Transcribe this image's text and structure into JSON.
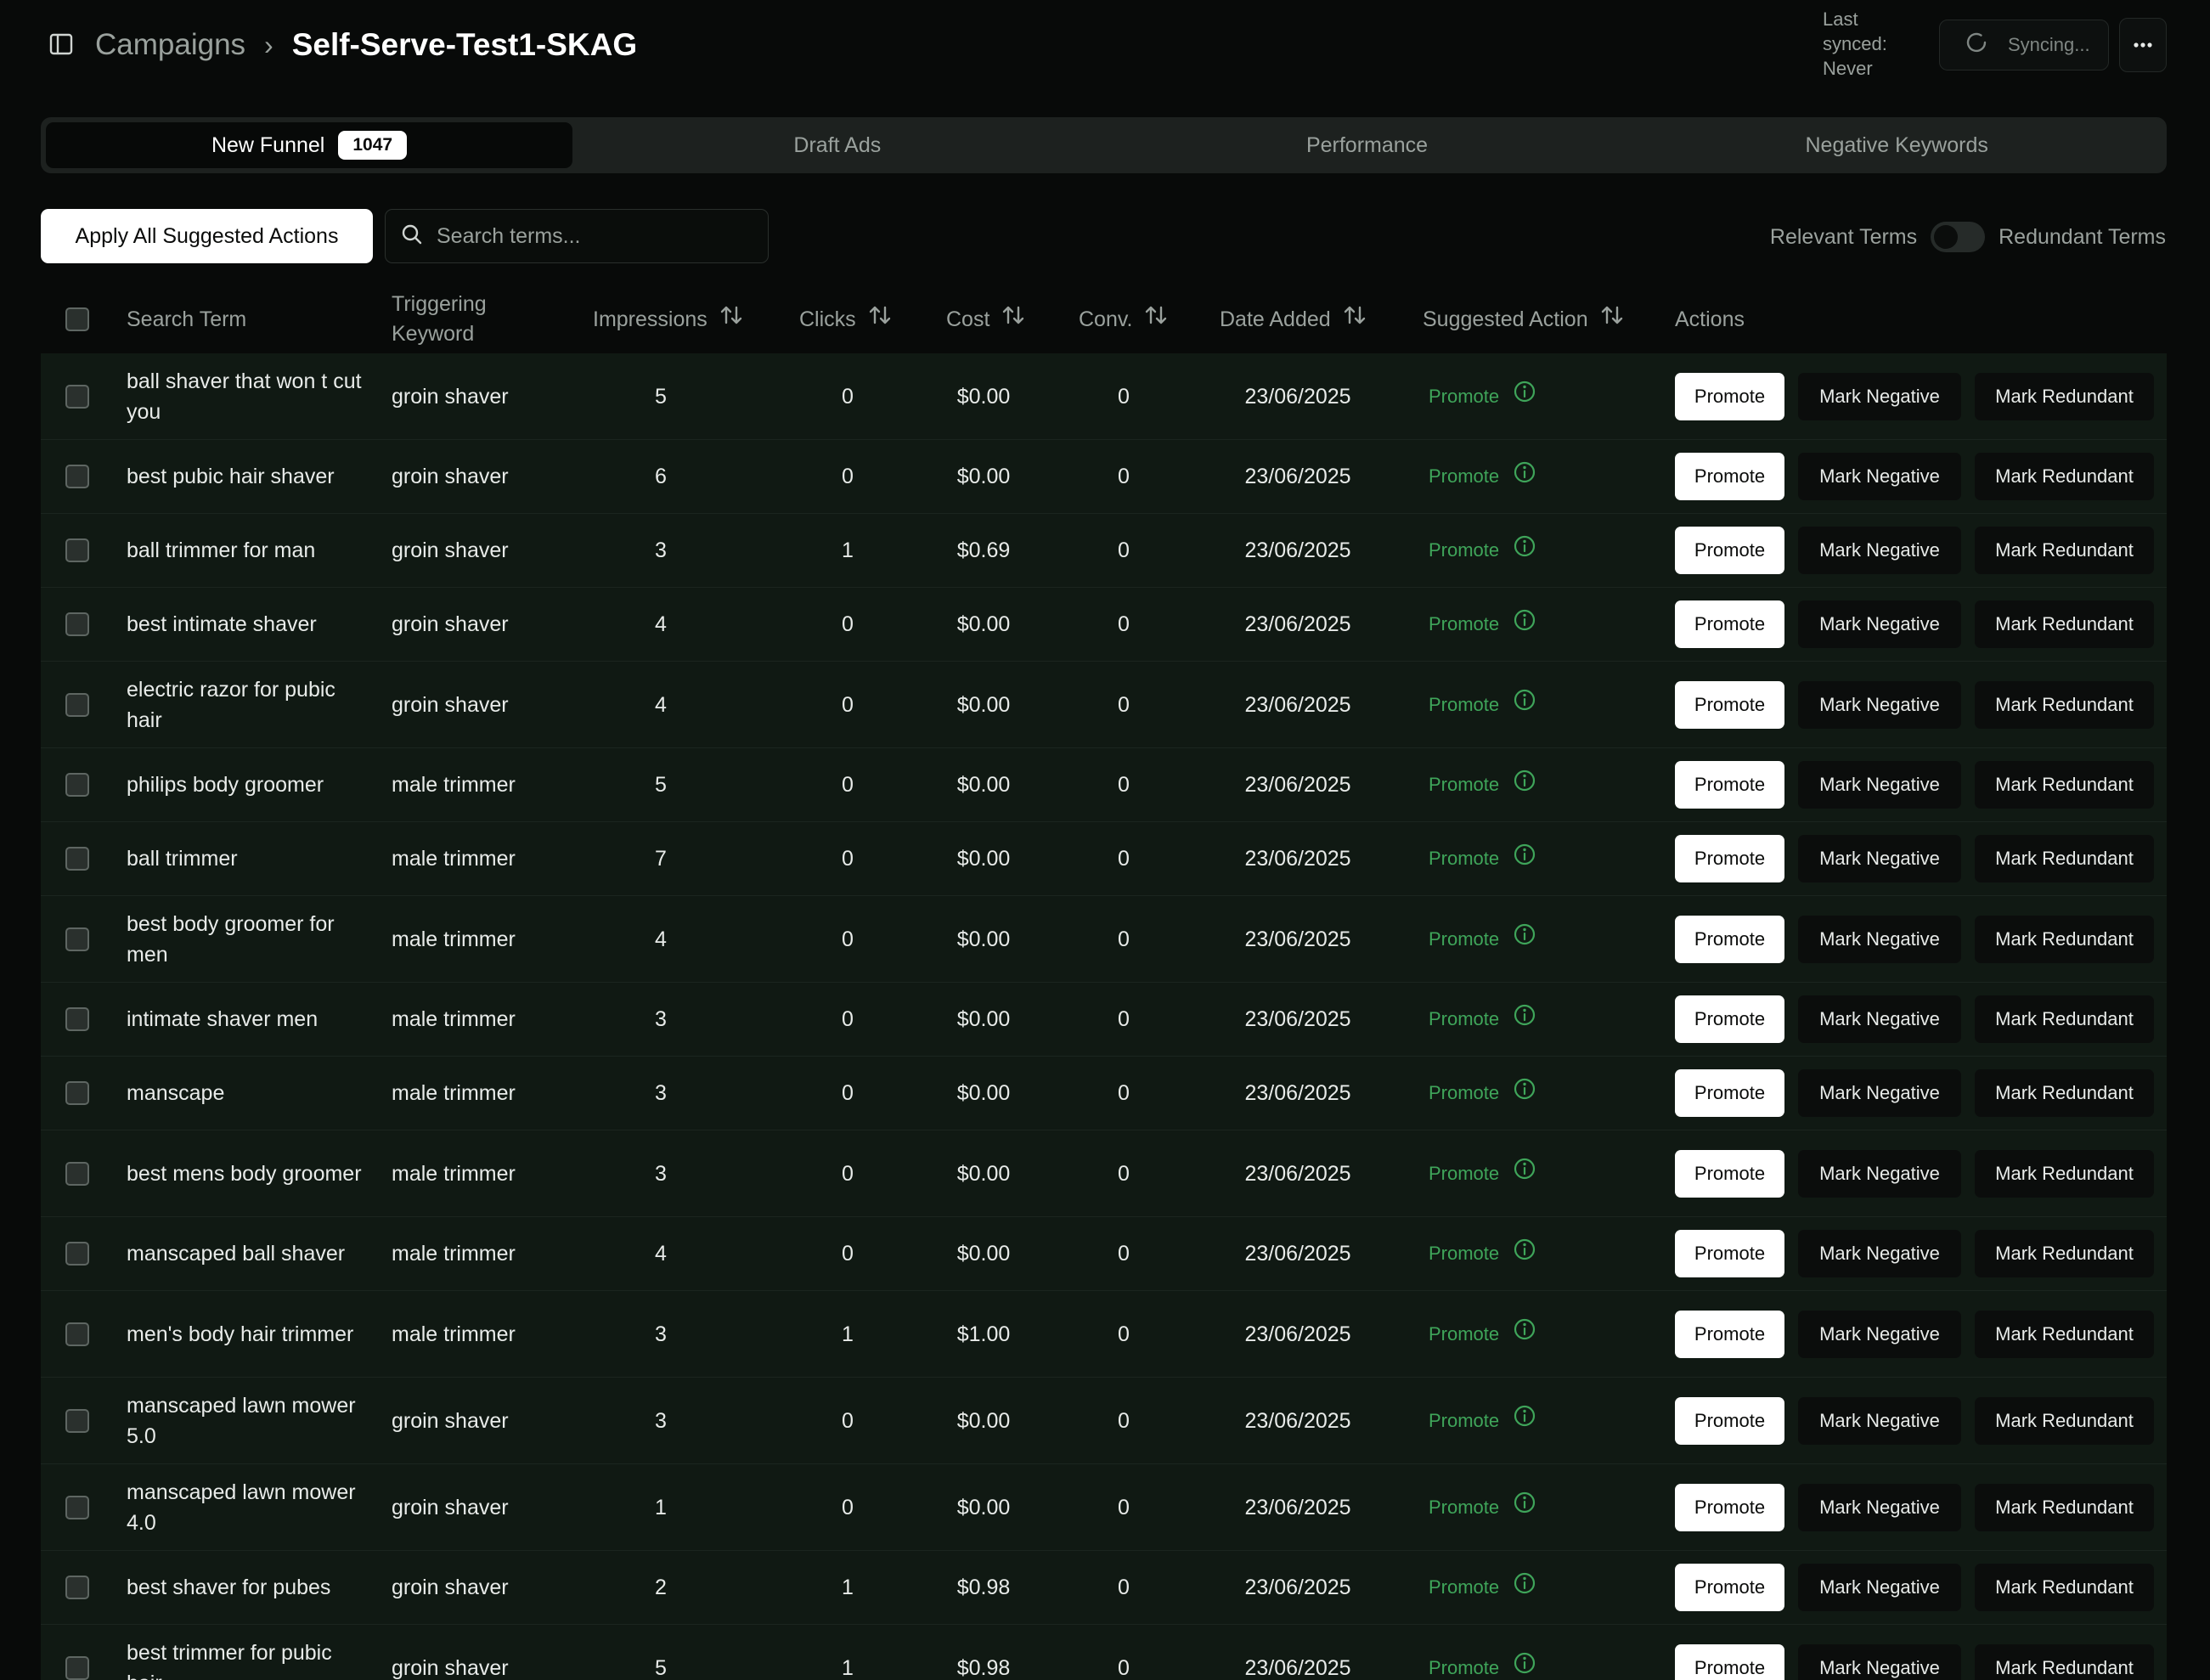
{
  "header": {
    "breadcrumb_parent": "Campaigns",
    "breadcrumb_sep": "›",
    "title": "Self-Serve-Test1-SKAG",
    "last_synced_label": "Last synced: Never",
    "sync_label": "Syncing..."
  },
  "tabs": [
    {
      "label": "New Funnel",
      "badge": "1047"
    },
    {
      "label": "Draft Ads"
    },
    {
      "label": "Performance"
    },
    {
      "label": "Negative Keywords"
    }
  ],
  "toolbar": {
    "apply_label": "Apply All Suggested Actions",
    "search_placeholder": "Search terms...",
    "toggle_left": "Relevant Terms",
    "toggle_right": "Redundant Terms"
  },
  "columns": {
    "search_term": "Search Term",
    "triggering_keyword_line1": "Triggering",
    "triggering_keyword_line2": "Keyword",
    "impressions": "Impressions",
    "clicks": "Clicks",
    "cost": "Cost",
    "conv": "Conv.",
    "date_added": "Date Added",
    "suggested_action": "Suggested Action",
    "actions": "Actions"
  },
  "action_labels": {
    "promote": "Promote",
    "mark_negative": "Mark Negative",
    "mark_redundant": "Mark Redundant"
  },
  "rows": [
    {
      "term": "ball shaver that won t cut you",
      "keyword": "groin shaver",
      "impressions": "5",
      "clicks": "0",
      "cost": "$0.00",
      "conv": "0",
      "date": "23/06/2025",
      "suggested": "Promote"
    },
    {
      "term": "best pubic hair shaver",
      "keyword": "groin shaver",
      "impressions": "6",
      "clicks": "0",
      "cost": "$0.00",
      "conv": "0",
      "date": "23/06/2025",
      "suggested": "Promote"
    },
    {
      "term": "ball trimmer for man",
      "keyword": "groin shaver",
      "impressions": "3",
      "clicks": "1",
      "cost": "$0.69",
      "conv": "0",
      "date": "23/06/2025",
      "suggested": "Promote"
    },
    {
      "term": "best intimate shaver",
      "keyword": "groin shaver",
      "impressions": "4",
      "clicks": "0",
      "cost": "$0.00",
      "conv": "0",
      "date": "23/06/2025",
      "suggested": "Promote"
    },
    {
      "term": "electric razor for pubic hair",
      "keyword": "groin shaver",
      "impressions": "4",
      "clicks": "0",
      "cost": "$0.00",
      "conv": "0",
      "date": "23/06/2025",
      "suggested": "Promote"
    },
    {
      "term": "philips body groomer",
      "keyword": "male trimmer",
      "impressions": "5",
      "clicks": "0",
      "cost": "$0.00",
      "conv": "0",
      "date": "23/06/2025",
      "suggested": "Promote"
    },
    {
      "term": "ball trimmer",
      "keyword": "male trimmer",
      "impressions": "7",
      "clicks": "0",
      "cost": "$0.00",
      "conv": "0",
      "date": "23/06/2025",
      "suggested": "Promote"
    },
    {
      "term": "best body groomer for men",
      "keyword": "male trimmer",
      "impressions": "4",
      "clicks": "0",
      "cost": "$0.00",
      "conv": "0",
      "date": "23/06/2025",
      "suggested": "Promote"
    },
    {
      "term": "intimate shaver men",
      "keyword": "male trimmer",
      "impressions": "3",
      "clicks": "0",
      "cost": "$0.00",
      "conv": "0",
      "date": "23/06/2025",
      "suggested": "Promote"
    },
    {
      "term": "manscape",
      "keyword": "male trimmer",
      "impressions": "3",
      "clicks": "0",
      "cost": "$0.00",
      "conv": "0",
      "date": "23/06/2025",
      "suggested": "Promote"
    },
    {
      "term": "best mens body groomer",
      "keyword": "male trimmer",
      "impressions": "3",
      "clicks": "0",
      "cost": "$0.00",
      "conv": "0",
      "date": "23/06/2025",
      "suggested": "Promote"
    },
    {
      "term": "manscaped ball shaver",
      "keyword": "male trimmer",
      "impressions": "4",
      "clicks": "0",
      "cost": "$0.00",
      "conv": "0",
      "date": "23/06/2025",
      "suggested": "Promote"
    },
    {
      "term": "men's body hair trimmer",
      "keyword": "male trimmer",
      "impressions": "3",
      "clicks": "1",
      "cost": "$1.00",
      "conv": "0",
      "date": "23/06/2025",
      "suggested": "Promote"
    },
    {
      "term": "manscaped lawn mower 5.0",
      "keyword": "groin shaver",
      "impressions": "3",
      "clicks": "0",
      "cost": "$0.00",
      "conv": "0",
      "date": "23/06/2025",
      "suggested": "Promote"
    },
    {
      "term": "manscaped lawn mower 4.0",
      "keyword": "groin shaver",
      "impressions": "1",
      "clicks": "0",
      "cost": "$0.00",
      "conv": "0",
      "date": "23/06/2025",
      "suggested": "Promote"
    },
    {
      "term": "best shaver for pubes",
      "keyword": "groin shaver",
      "impressions": "2",
      "clicks": "1",
      "cost": "$0.98",
      "conv": "0",
      "date": "23/06/2025",
      "suggested": "Promote"
    },
    {
      "term": "best trimmer for pubic hair",
      "keyword": "groin shaver",
      "impressions": "5",
      "clicks": "1",
      "cost": "$0.98",
      "conv": "0",
      "date": "23/06/2025",
      "suggested": "Promote"
    }
  ]
}
